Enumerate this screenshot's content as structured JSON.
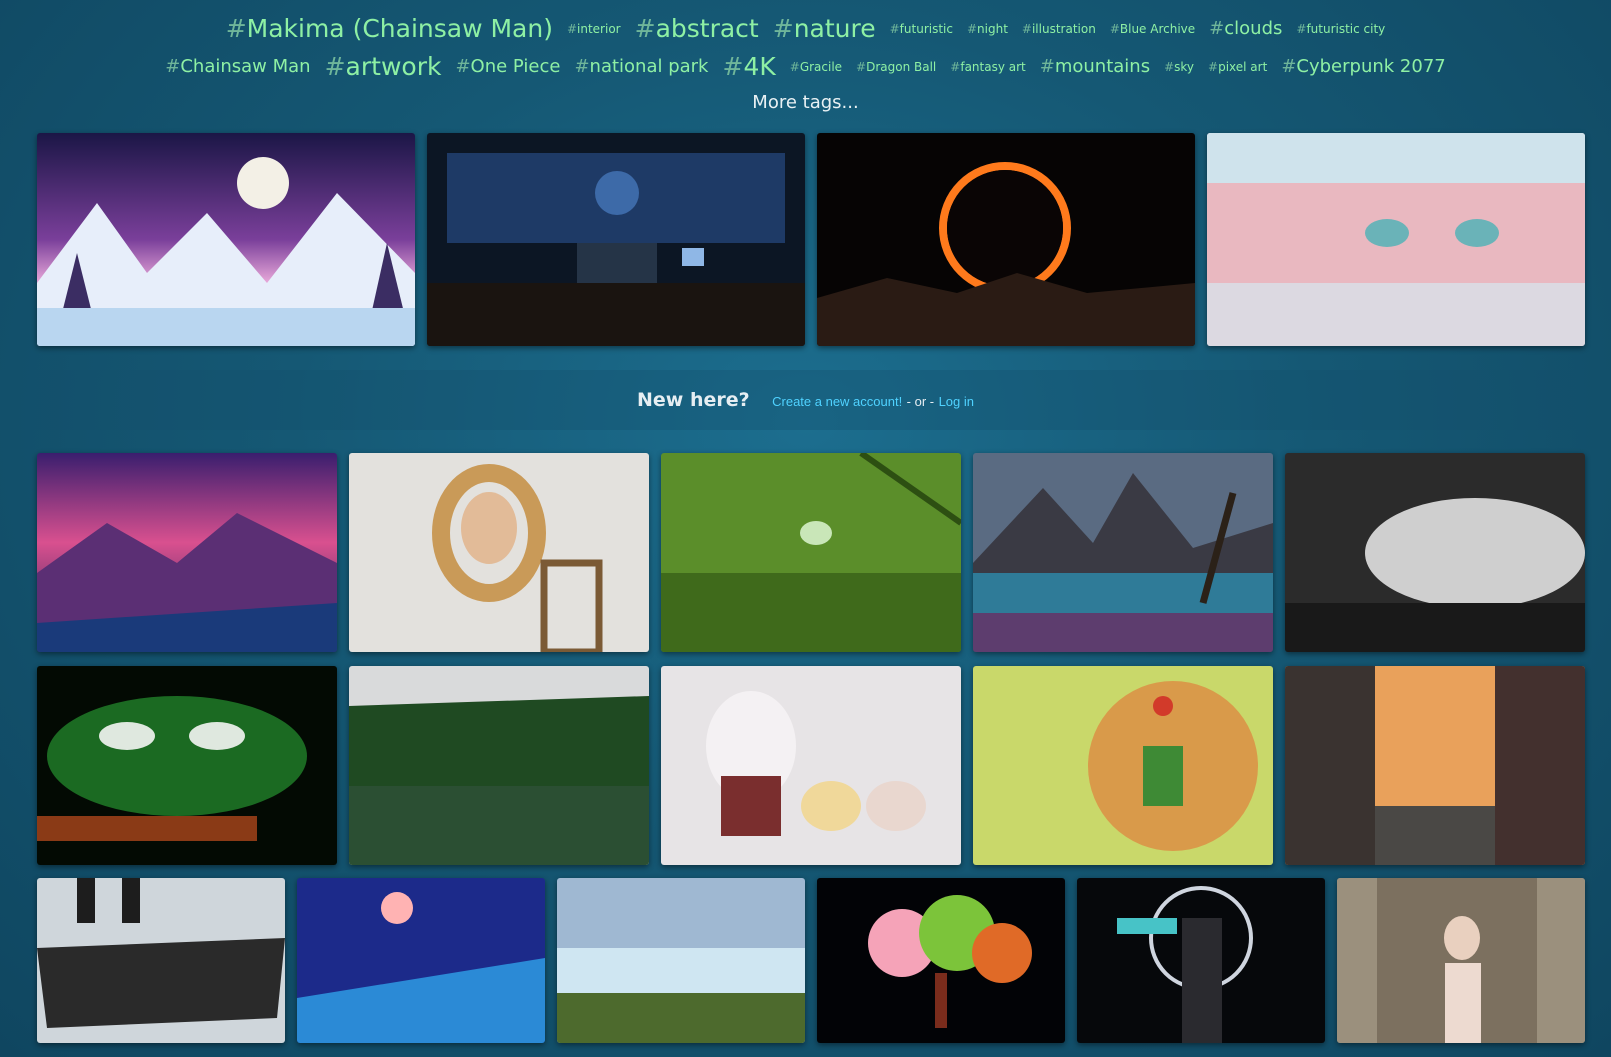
{
  "tags_row_1": [
    {
      "name": "Makima (Chainsaw Man)",
      "size": "s3"
    },
    {
      "name": "interior",
      "size": "s1"
    },
    {
      "name": "abstract",
      "size": "s3"
    },
    {
      "name": "nature",
      "size": "s3"
    },
    {
      "name": "futuristic",
      "size": "s1"
    },
    {
      "name": "night",
      "size": "s1"
    },
    {
      "name": "illustration",
      "size": "s1"
    },
    {
      "name": "Blue Archive",
      "size": "s1"
    },
    {
      "name": "clouds",
      "size": "s2"
    },
    {
      "name": "futuristic city",
      "size": "s1"
    }
  ],
  "tags_row_2": [
    {
      "name": "Chainsaw Man",
      "size": "s2"
    },
    {
      "name": "artwork",
      "size": "s3"
    },
    {
      "name": "One Piece",
      "size": "s2"
    },
    {
      "name": "national park",
      "size": "s2"
    },
    {
      "name": "4K",
      "size": "s3"
    },
    {
      "name": "Gracile",
      "size": "s1"
    },
    {
      "name": "Dragon Ball",
      "size": "s1"
    },
    {
      "name": "fantasy art",
      "size": "s1"
    },
    {
      "name": "mountains",
      "size": "s2"
    },
    {
      "name": "sky",
      "size": "s1"
    },
    {
      "name": "pixel art",
      "size": "s1"
    },
    {
      "name": "Cyberpunk 2077",
      "size": "s2"
    }
  ],
  "hash_symbol": "#",
  "more_tags_label": "More tags...",
  "new_here": {
    "title": "New here?",
    "create_account": "Create a new account!",
    "separator": "- or -",
    "login": "Log in"
  },
  "colors": {
    "background": "#155874",
    "tag": "#8ef0a4",
    "link": "#4fd2ff"
  }
}
